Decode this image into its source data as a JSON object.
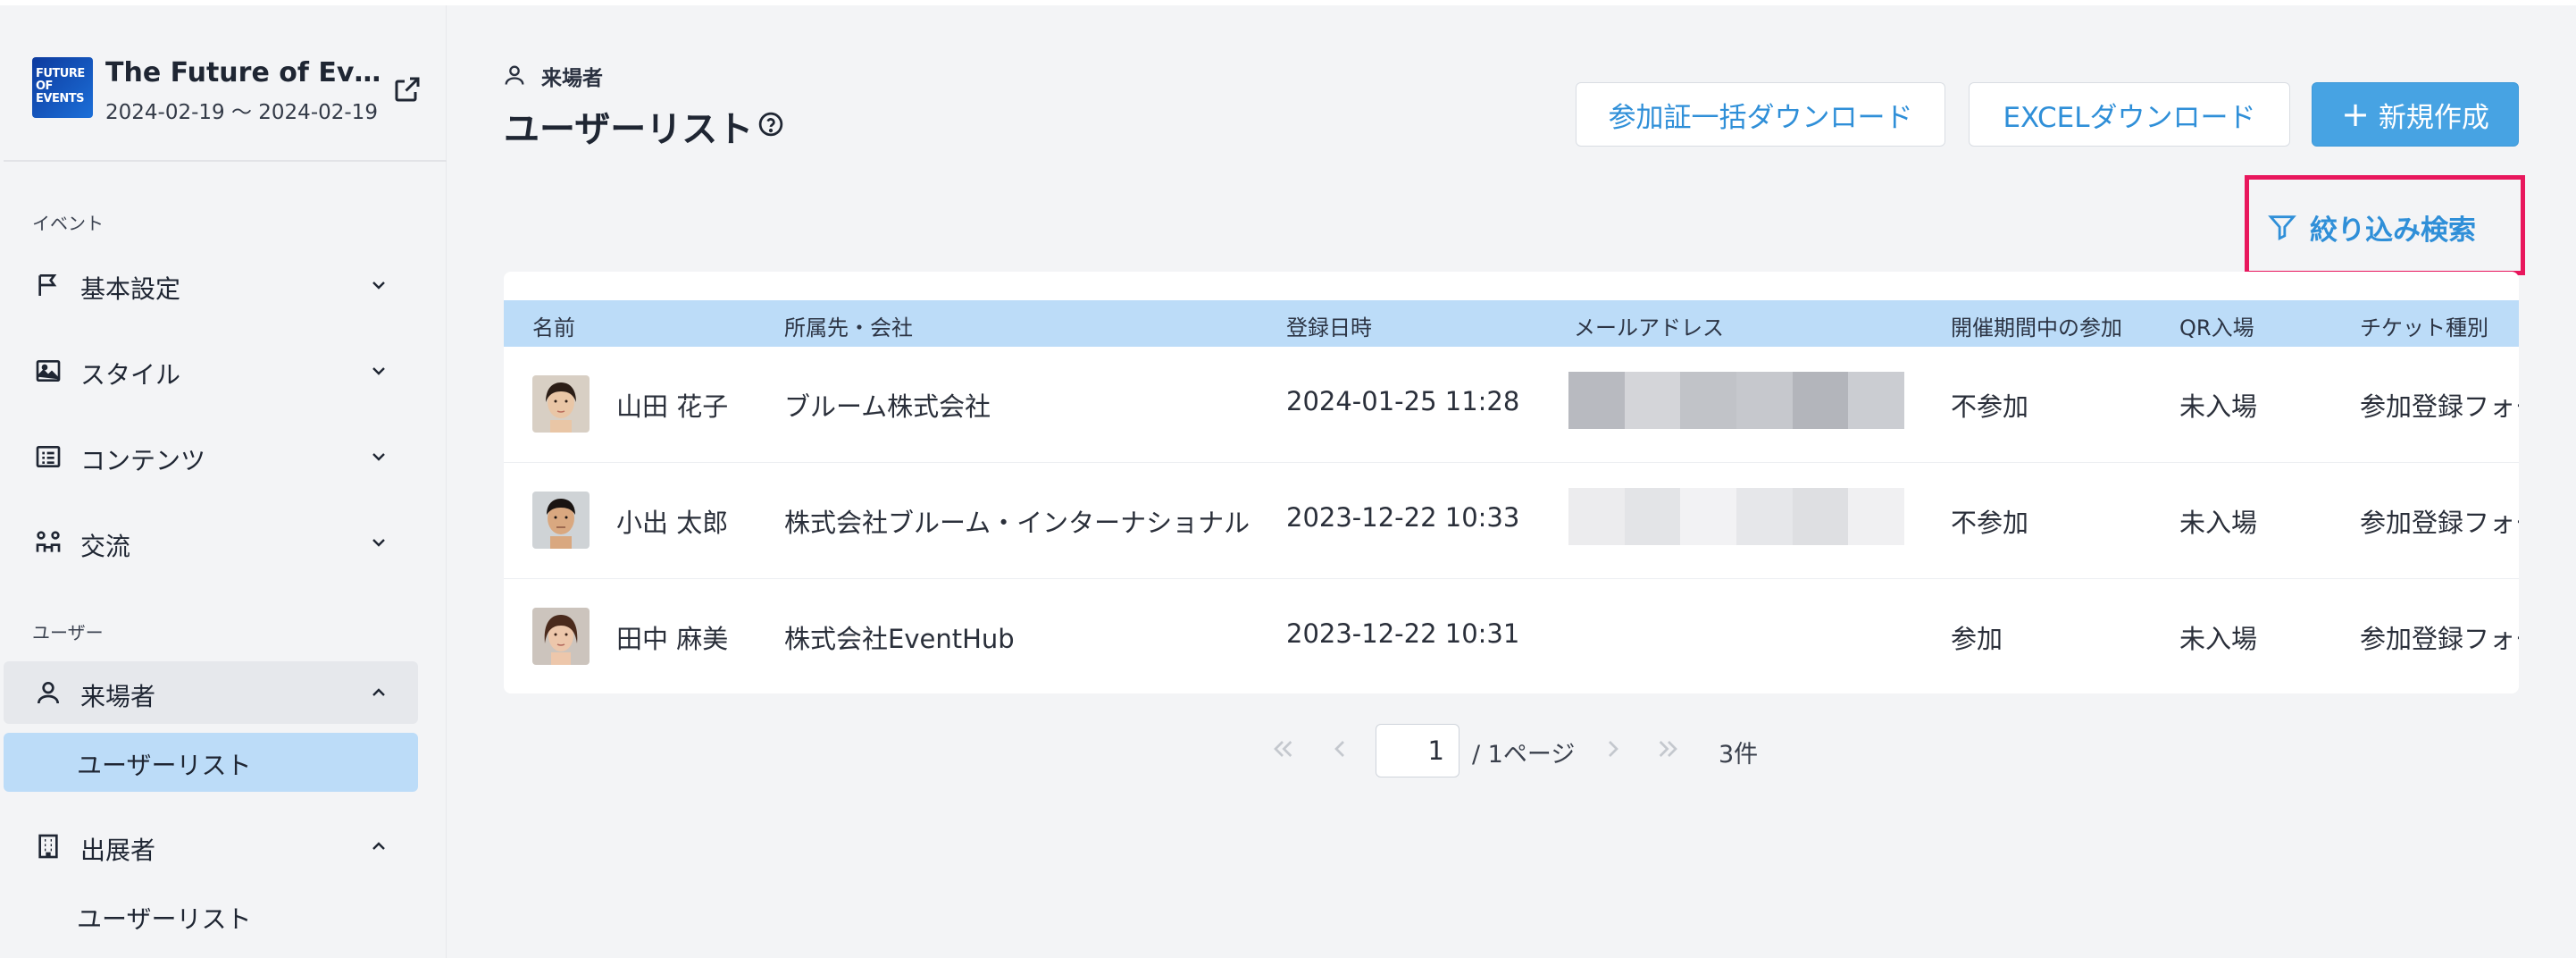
{
  "event": {
    "logo_text": "FUTURE OF EVENTS",
    "title": "The Future of Events",
    "dates": "2024-02-19 〜 2024-02-19"
  },
  "sidebar": {
    "section_event": "イベント",
    "section_user": "ユーザー",
    "items": [
      {
        "label": "基本設定",
        "icon": "flag-icon"
      },
      {
        "label": "スタイル",
        "icon": "image-icon"
      },
      {
        "label": "コンテンツ",
        "icon": "list-icon"
      },
      {
        "label": "交流",
        "icon": "network-icon"
      },
      {
        "label": "来場者",
        "icon": "user-icon"
      },
      {
        "label": "出展者",
        "icon": "building-icon"
      }
    ],
    "visitor_sub": "ユーザーリスト",
    "exhibitor_sub": "ユーザーリスト"
  },
  "header": {
    "breadcrumb": "来場者",
    "title": "ユーザーリスト"
  },
  "toolbar": {
    "bulk_download": "参加証一括ダウンロード",
    "excel_download": "EXCELダウンロード",
    "create_new": "新規作成",
    "filter": "絞り込み検索"
  },
  "table": {
    "columns": [
      "名前",
      "所属先・会社",
      "登録日時",
      "メールアドレス",
      "開催期間中の参加",
      "QR入場",
      "チケット種別"
    ],
    "rows": [
      {
        "name": "山田 花子",
        "company": "ブルーム株式会社",
        "registered": "2024-01-25 11:28",
        "participation": "不参加",
        "qr": "未入場",
        "ticket": "参加登録フォーム"
      },
      {
        "name": "小出 太郎",
        "company": "株式会社ブルーム・インターナショナル",
        "registered": "2023-12-22 10:33",
        "participation": "不参加",
        "qr": "未入場",
        "ticket": "参加登録フォーム"
      },
      {
        "name": "田中 麻美",
        "company": "株式会社EventHub",
        "registered": "2023-12-22 10:31",
        "participation": "参加",
        "qr": "未入場",
        "ticket": "参加登録フォーム"
      }
    ]
  },
  "pagination": {
    "current_page": "1",
    "page_total": "/ 1ページ",
    "count": "3件"
  },
  "colors": {
    "accent": "#47a3e3",
    "link": "#2f8fd8",
    "highlight_border": "#e8175d",
    "header_bg": "#bcdcf8"
  }
}
